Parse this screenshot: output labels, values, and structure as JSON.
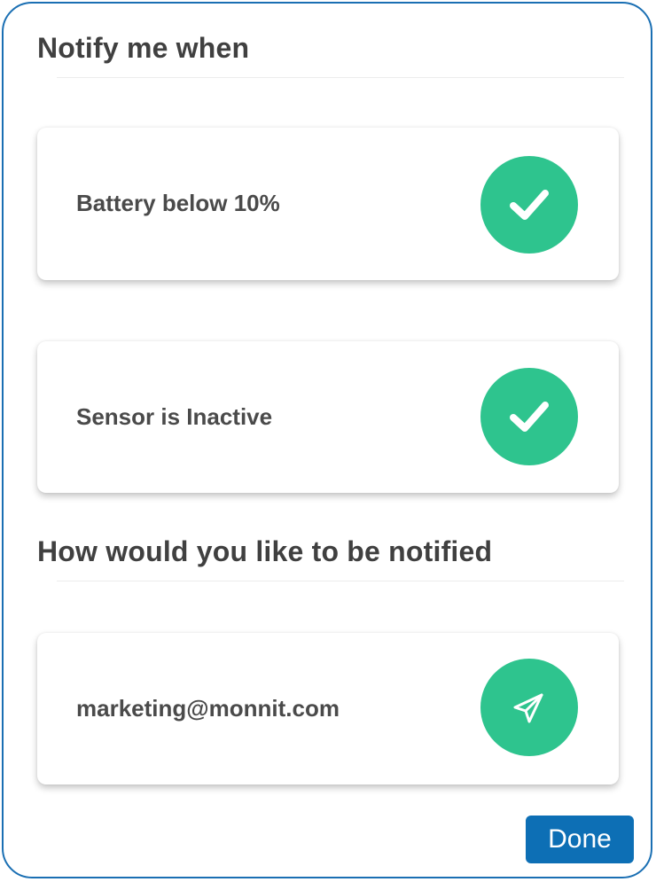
{
  "notify_section": {
    "title": "Notify me when",
    "conditions": [
      {
        "label": "Battery below 10%",
        "icon": "checkmark-icon",
        "checked": true
      },
      {
        "label": "Sensor is Inactive",
        "icon": "checkmark-icon",
        "checked": true
      }
    ]
  },
  "method_section": {
    "title": "How would you like to be notified",
    "email": {
      "label": "marketing@monnit.com",
      "icon": "send-icon"
    }
  },
  "footer": {
    "done_label": "Done"
  },
  "colors": {
    "accent_green": "#2ec48e",
    "primary_blue": "#0d6fb5",
    "frame_border": "#1a6fb3",
    "text": "#404040"
  }
}
